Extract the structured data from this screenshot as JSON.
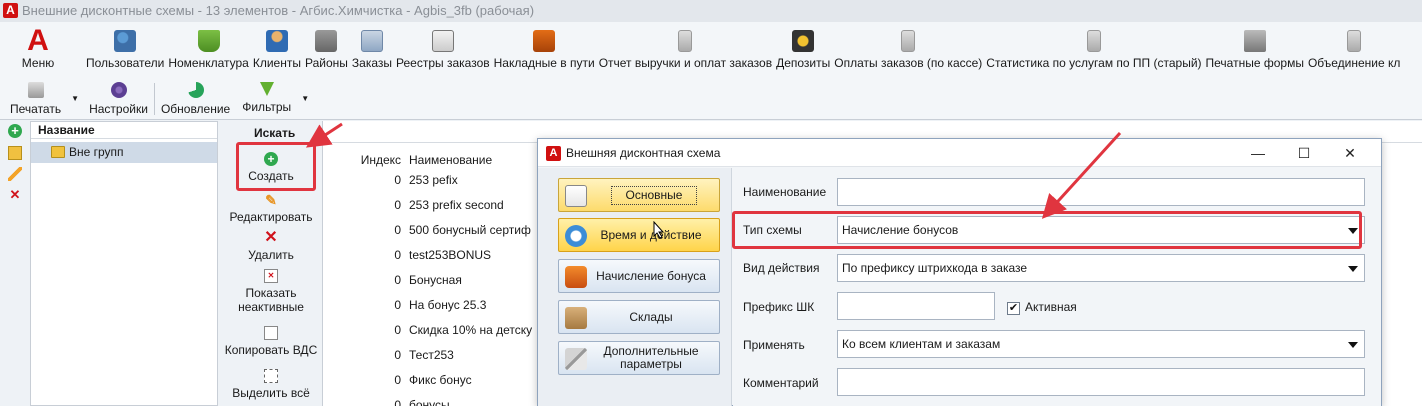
{
  "window": {
    "title": "Внешние дисконтные схемы - 13 элементов - Агбис.Химчистка - Agbis_3fb (рабочая)",
    "logo_letter": "A"
  },
  "ribbon": {
    "menu_label": "Меню",
    "menu_letter": "A",
    "tools": [
      {
        "label": "Пользователи",
        "icon": "users-icon"
      },
      {
        "label": "Номенклатура",
        "icon": "basket-icon"
      },
      {
        "label": "Клиенты",
        "icon": "client-icon"
      },
      {
        "label": "Районы",
        "icon": "district-icon"
      },
      {
        "label": "Заказы",
        "icon": "orders-icon"
      },
      {
        "label": "Реестры заказов",
        "icon": "registry-icon"
      },
      {
        "label": "Накладные в пути",
        "icon": "truck-icon"
      },
      {
        "label": "Отчет выручки и оплат заказов",
        "icon": "report-icon"
      },
      {
        "label": "Депозиты",
        "icon": "deposit-icon"
      },
      {
        "label": "Оплаты заказов (по кассе)",
        "icon": "report-icon"
      },
      {
        "label": "Статистика по услугам по ПП (старый)",
        "icon": "report-icon"
      },
      {
        "label": "Печатные формы",
        "icon": "printer-icon"
      },
      {
        "label": "Объединение кл",
        "icon": "report-icon"
      }
    ],
    "row2": {
      "print_label": "Печатать",
      "settings_label": "Настройки",
      "refresh_label": "Обновление",
      "filters_label": "Фильтры"
    }
  },
  "tree": {
    "header": "Название",
    "node_label": "Вне групп"
  },
  "actions": {
    "search_label": "Искать",
    "create_label": "Создать",
    "edit_label": "Редактировать",
    "delete_label": "Удалить",
    "show_inactive_label": "Показать неактивные",
    "copy_label": "Копировать ВДС",
    "select_all_label": "Выделить всё"
  },
  "grid": {
    "col_index": "Индекс",
    "col_name": "Наименование",
    "rows": [
      {
        "index": "0",
        "name": "253 pefix"
      },
      {
        "index": "0",
        "name": "253 prefix second"
      },
      {
        "index": "0",
        "name": "500 бонусный сертиф"
      },
      {
        "index": "0",
        "name": "test253BONUS"
      },
      {
        "index": "0",
        "name": "Бонусная"
      },
      {
        "index": "0",
        "name": "На бонус 25.3"
      },
      {
        "index": "0",
        "name": "Скидка 10% на детску"
      },
      {
        "index": "0",
        "name": "Тест253"
      },
      {
        "index": "0",
        "name": "Фикс бонус"
      },
      {
        "index": "0",
        "name": "бонусы"
      }
    ]
  },
  "dialog": {
    "title": "Внешняя дисконтная схема",
    "logo_letter": "A",
    "min_glyph": "—",
    "max_glyph": "☐",
    "close_glyph": "✕",
    "nav": {
      "basic": "Основные",
      "time_action": "Время и действие",
      "bonus_accrual": "Начисление бонуса",
      "warehouses": "Склады",
      "additional_params": "Дополнительные параметры"
    },
    "form": {
      "name_label": "Наименование",
      "name_value": "",
      "scheme_type_label": "Тип схемы",
      "scheme_type_value": "Начисление бонусов",
      "action_type_label": "Вид действия",
      "action_type_value": "По префиксу штрихкода в заказе",
      "prefix_label": "Префикс ШК",
      "prefix_value": "",
      "active_label": "Активная",
      "active_checked": "✔",
      "apply_label": "Применять",
      "apply_value": "Ко всем клиентам и заказам",
      "comment_label": "Комментарий",
      "comment_value": ""
    }
  },
  "colors": {
    "annotation_red": "#e0353f",
    "brand_red": "#d01010",
    "active_nav_yellow": "#fddb6c"
  }
}
